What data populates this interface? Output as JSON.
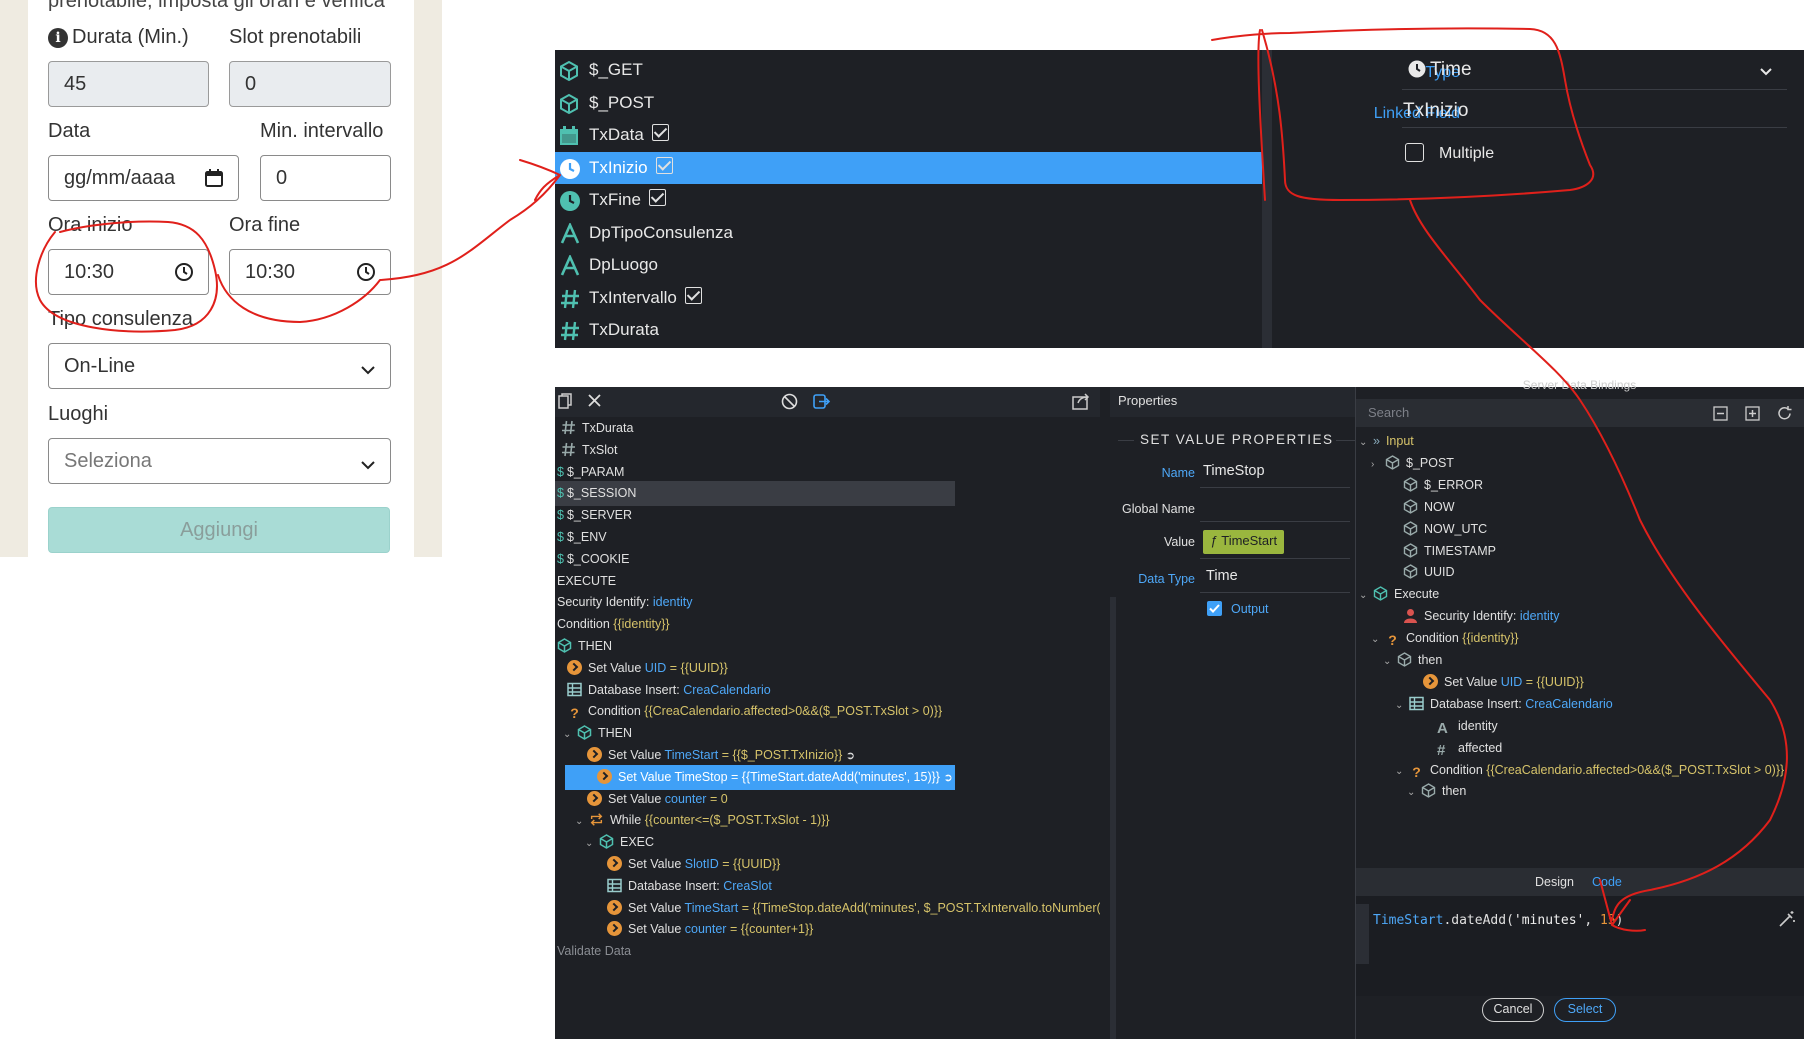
{
  "form": {
    "top_cut_text": "prenotabile, imposta gli orari e verifica",
    "durata_label": "Durata (Min.)",
    "durata_value": "45",
    "slot_label": "Slot prenotabili",
    "slot_value": "0",
    "data_label": "Data",
    "data_placeholder": "gg/mm/aaaa",
    "min_intervallo_label": "Min. intervallo",
    "min_intervallo_value": "0",
    "ora_inizio_label": "Ora inizio",
    "ora_inizio_value": "10:30",
    "ora_fine_label": "Ora fine",
    "ora_fine_value": "10:30",
    "tipo_label": "Tipo consulenza",
    "tipo_value": "On-Line",
    "luoghi_label": "Luoghi",
    "luoghi_value": "Seleziona",
    "add_button": "Aggiungi"
  },
  "tree_top": {
    "items": [
      {
        "label": "$_GET",
        "icon": "cube-icon"
      },
      {
        "label": "$_POST",
        "icon": "cube-icon"
      },
      {
        "label": "TxData",
        "icon": "calendar-icon",
        "checked": true
      },
      {
        "label": "TxInizio",
        "icon": "clock-icon",
        "checked": true,
        "selected": true
      },
      {
        "label": "TxFine",
        "icon": "clock-icon",
        "checked": true
      },
      {
        "label": "DpTipoConsulenza",
        "icon": "text-icon"
      },
      {
        "label": "DpLuogo",
        "icon": "text-icon"
      },
      {
        "label": "TxIntervallo",
        "icon": "hash-icon",
        "checked": true
      },
      {
        "label": "TxDurata",
        "icon": "hash-icon"
      }
    ]
  },
  "props_top": {
    "type_label": "Type",
    "type_value": "Time",
    "linked_label": "Linked Field",
    "linked_value": "TxInizio",
    "multiple_label": "Multiple"
  },
  "props_mid": {
    "header": "Properties",
    "section_title": "SET VALUE PROPERTIES",
    "name_label": "Name",
    "name_value": "TimeStop",
    "global_label": "Global Name",
    "value_label": "Value",
    "value_value": "TimeStart",
    "datatype_label": "Data Type",
    "datatype_value": "Time",
    "output_label": "Output"
  },
  "tree_bottom": {
    "rows": [
      {
        "pre": "",
        "name": "TxDurata"
      },
      {
        "pre": "",
        "name": "TxSlot"
      },
      {
        "pre": "",
        "name": "$_PARAM"
      },
      {
        "pre": "",
        "name": "$_SESSION"
      },
      {
        "pre": "",
        "name": "$_SERVER"
      },
      {
        "pre": "",
        "name": "$_ENV"
      },
      {
        "pre": "",
        "name": "$_COOKIE"
      },
      {
        "pre": "",
        "name": "EXECUTE"
      },
      {
        "pre": "Security Identify: ",
        "name": "identity"
      },
      {
        "pre": "Condition ",
        "name": "{{identity}}"
      },
      {
        "pre": "",
        "name": "THEN"
      },
      {
        "pre": "Set Value ",
        "name": "UID",
        "post": " = {{UUID}}"
      },
      {
        "pre": "Database Insert: ",
        "name": "CreaCalendario"
      },
      {
        "pre": "Condition ",
        "name": "{{CreaCalendario.affected>0&&($_POST.TxSlot > 0)}}"
      },
      {
        "pre": "",
        "name": "THEN"
      },
      {
        "pre": "Set Value ",
        "name": "TimeStart",
        "post": " = {{$_POST.TxInizio}}"
      },
      {
        "pre": "Set Value ",
        "name": "TimeStop",
        "post": " = {{TimeStart.dateAdd('minutes', 15)}}"
      },
      {
        "pre": "Set Value ",
        "name": "counter",
        "post": " = 0"
      },
      {
        "pre": "While ",
        "name": "{{counter<=($_POST.TxSlot - 1)}}"
      },
      {
        "pre": "",
        "name": "EXEC"
      },
      {
        "pre": "Set Value ",
        "name": "SlotID",
        "post": " = {{UUID}}"
      },
      {
        "pre": "Database Insert: ",
        "name": "CreaSlot"
      },
      {
        "pre": "Set Value ",
        "name": "TimeStart",
        "post": " = {{TimeStop.dateAdd('minutes', $_POST.TxIntervallo.toNumber("
      },
      {
        "pre": "Set Value ",
        "name": "counter",
        "post": " = {{counter+1}}"
      },
      {
        "pre": "",
        "name": "Validate Data"
      }
    ]
  },
  "bindings": {
    "header_cut": "Server Data Bindings",
    "search_placeholder": "Search",
    "rows": [
      {
        "pre": "",
        "name": "Input"
      },
      {
        "pre": "",
        "name": "$_POST"
      },
      {
        "pre": "",
        "name": "$_ERROR"
      },
      {
        "pre": "",
        "name": "NOW"
      },
      {
        "pre": "",
        "name": "NOW_UTC"
      },
      {
        "pre": "",
        "name": "TIMESTAMP"
      },
      {
        "pre": "",
        "name": "UUID"
      },
      {
        "pre": "",
        "name": "Execute"
      },
      {
        "pre": "Security Identify: ",
        "name": "identity"
      },
      {
        "pre": "Condition ",
        "name": "{{identity}}"
      },
      {
        "pre": "",
        "name": "then"
      },
      {
        "pre": "Set Value ",
        "name": "UID",
        "post": " = {{UUID}}"
      },
      {
        "pre": "Database Insert: ",
        "name": "CreaCalendario"
      },
      {
        "pre": "",
        "name": "identity"
      },
      {
        "pre": "",
        "name": "affected"
      },
      {
        "pre": "Condition ",
        "name": "{{CreaCalendario.affected>0&&($_POST.TxSlot > 0)}}"
      },
      {
        "pre": "",
        "name": "then"
      }
    ],
    "tab_design": "Design",
    "tab_code": "Code",
    "code_obj": "TimeStart",
    "code_fn": ".dateAdd(",
    "code_str": "'minutes'",
    "code_sep": ", ",
    "code_num": "15",
    "code_end": ")",
    "cancel": "Cancel",
    "select": "Select"
  },
  "colors": {
    "accent": "#3fa0f7",
    "annotation": "#e0201b",
    "panel_bg": "#1e2025",
    "form_bg": "#efebe1",
    "button_teal": "#a9dcd6"
  }
}
